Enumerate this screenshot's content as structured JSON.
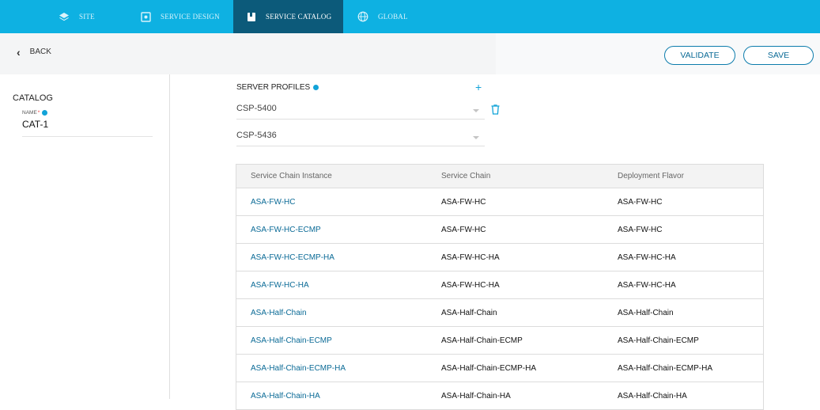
{
  "nav": {
    "tabs": [
      {
        "label": "SITE",
        "icon": "layers-icon"
      },
      {
        "label": "SERVICE DESIGN",
        "icon": "service-design-icon"
      },
      {
        "label": "SERVICE CATALOG",
        "icon": "book-icon"
      },
      {
        "label": "GLOBAL",
        "icon": "globe-icon"
      }
    ],
    "active_tab": "SERVICE CATALOG"
  },
  "toolbar": {
    "back_label": "BACK",
    "validate_label": "VALIDATE",
    "save_label": "SAVE"
  },
  "sidebar": {
    "title": "CATALOG",
    "name_label": "NAME",
    "name_required_mark": "*",
    "name_value": "CAT-1"
  },
  "server_profiles": {
    "title": "SERVER PROFILES",
    "add_label": "+",
    "profiles": [
      "CSP-5400",
      "CSP-5436"
    ]
  },
  "table": {
    "headers": [
      "Service Chain Instance",
      "Service Chain",
      "Deployment Flavor"
    ],
    "rows": [
      [
        "ASA-FW-HC",
        "ASA-FW-HC",
        "ASA-FW-HC"
      ],
      [
        "ASA-FW-HC-ECMP",
        "ASA-FW-HC",
        "ASA-FW-HC"
      ],
      [
        "ASA-FW-HC-ECMP-HA",
        "ASA-FW-HC-HA",
        "ASA-FW-HC-HA"
      ],
      [
        "ASA-FW-HC-HA",
        "ASA-FW-HC-HA",
        "ASA-FW-HC-HA"
      ],
      [
        "ASA-Half-Chain",
        "ASA-Half-Chain",
        "ASA-Half-Chain"
      ],
      [
        "ASA-Half-Chain-ECMP",
        "ASA-Half-Chain-ECMP",
        "ASA-Half-Chain-ECMP"
      ],
      [
        "ASA-Half-Chain-ECMP-HA",
        "ASA-Half-Chain-ECMP-HA",
        "ASA-Half-Chain-ECMP-HA"
      ],
      [
        "ASA-Half-Chain-HA",
        "ASA-Half-Chain-HA",
        "ASA-Half-Chain-HA"
      ]
    ]
  },
  "colors": {
    "nav_bg": "#0eb1e2",
    "nav_active_bg": "#0c5a7a",
    "accent": "#12a3d8",
    "link": "#0a6a96"
  }
}
